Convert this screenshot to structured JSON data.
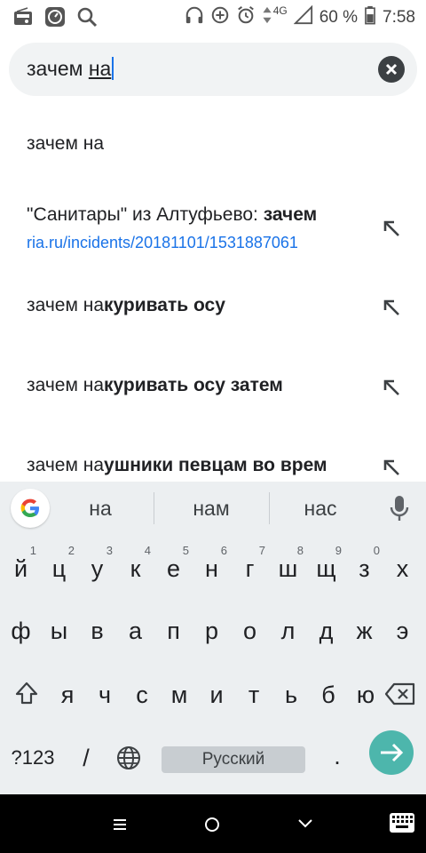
{
  "status_bar": {
    "network": "4G",
    "battery": "60 %",
    "time": "7:58"
  },
  "search": {
    "query_prefix": "зачем ",
    "query_composing": "на"
  },
  "suggestions": [
    {
      "prefix": "зачем на",
      "bold": "",
      "sub": ""
    },
    {
      "prefix": "\"Санитары\" из Алтуфьево: ",
      "bold": "зачем",
      "sub": "ria.ru/incidents/20181101/1531887061"
    },
    {
      "prefix": "зачем на",
      "bold": "куривать осу",
      "sub": ""
    },
    {
      "prefix": "зачем на",
      "bold": "куривать осу затем",
      "sub": ""
    },
    {
      "prefix": "зачем на",
      "bold": "ушники певцам во врем",
      "sub": ""
    }
  ],
  "keyboard": {
    "predictions": [
      "на",
      "нам",
      "нас"
    ],
    "row1": [
      {
        "ch": "й",
        "hint": "1"
      },
      {
        "ch": "ц",
        "hint": "2"
      },
      {
        "ch": "у",
        "hint": "3"
      },
      {
        "ch": "к",
        "hint": "4"
      },
      {
        "ch": "е",
        "hint": "5"
      },
      {
        "ch": "н",
        "hint": "6"
      },
      {
        "ch": "г",
        "hint": "7"
      },
      {
        "ch": "ш",
        "hint": "8"
      },
      {
        "ch": "щ",
        "hint": "9"
      },
      {
        "ch": "з",
        "hint": "0"
      },
      {
        "ch": "х",
        "hint": ""
      }
    ],
    "row2": [
      "ф",
      "ы",
      "в",
      "а",
      "п",
      "р",
      "о",
      "л",
      "д",
      "ж",
      "э"
    ],
    "row3": [
      "я",
      "ч",
      "с",
      "м",
      "и",
      "т",
      "ь",
      "б",
      "ю"
    ],
    "symbols_label": "?123",
    "slash_label": "/",
    "space_label": "Русский",
    "period_label": ".",
    "accent_color": "#4db6ac"
  }
}
